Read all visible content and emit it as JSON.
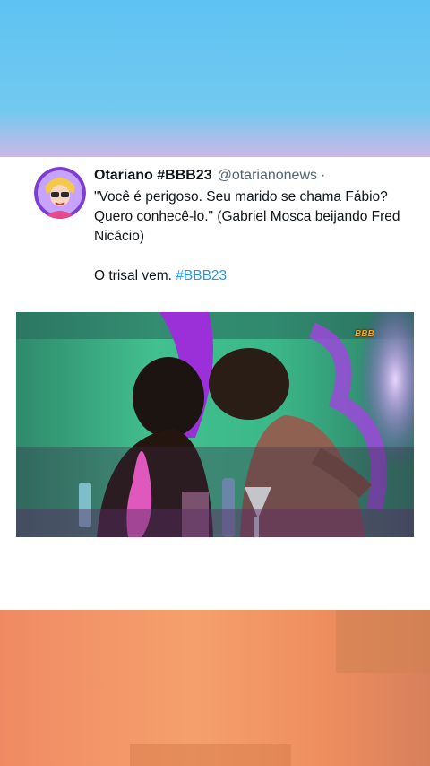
{
  "tweet": {
    "display_name": "Otariano #BBB23",
    "handle": "@otarianonews",
    "separator": "·",
    "text_line1": "\"Você é perigoso. Seu marido se chama Fábio? Quero conhecê-lo.\" (Gabriel Mosca beijando Fred Nicácio)",
    "text_line2_prefix": "O trisal vem.",
    "hashtag": "#BBB23"
  },
  "media": {
    "description_icon": "video-frame",
    "watermark": "BBB"
  },
  "colors": {
    "hashtag": "#1d9bf0",
    "name": "#0f1419",
    "handle": "#536471"
  }
}
